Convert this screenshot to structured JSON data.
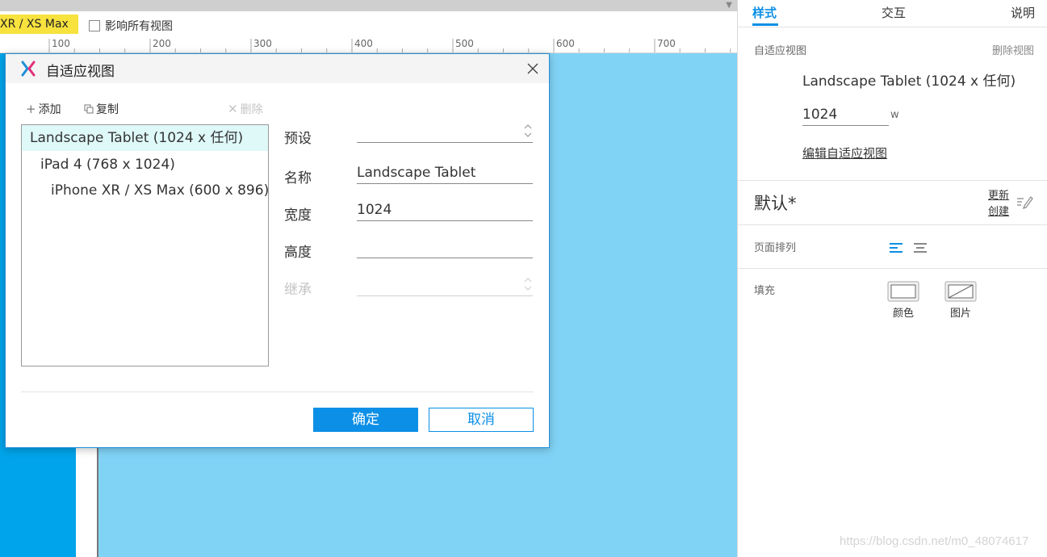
{
  "toolbar": {
    "current_view_chip": "XR / XS Max",
    "affect_all_views_label": "影响所有视图",
    "affect_all_views_checked": false
  },
  "ruler": {
    "ticks": [
      "100",
      "200",
      "300",
      "400",
      "500",
      "600",
      "700"
    ]
  },
  "dialog": {
    "title": "自适应视图",
    "toolbar": {
      "add_label": "添加",
      "copy_label": "复制",
      "delete_label": "删除"
    },
    "views": [
      {
        "label": "Landscape Tablet (1024 x 任何)",
        "selected": true
      },
      {
        "label": "iPad 4 (768 x 1024)",
        "selected": false
      },
      {
        "label": "iPhone XR / XS Max (600 x 896)",
        "selected": false
      }
    ],
    "form": {
      "preset_label": "预设",
      "preset_value": "",
      "name_label": "名称",
      "name_value": "Landscape Tablet",
      "width_label": "宽度",
      "width_value": "1024",
      "height_label": "高度",
      "height_value": "",
      "inherit_label": "继承",
      "inherit_value": ""
    },
    "ok_label": "确定",
    "cancel_label": "取消"
  },
  "panel": {
    "tabs": [
      {
        "label": "样式",
        "active": true
      },
      {
        "label": "交互",
        "active": false
      },
      {
        "label": "说明",
        "active": false
      }
    ],
    "adaptive_view_label": "自适应视图",
    "delete_view_label": "删除视图",
    "current_view_name": "Landscape Tablet (1024 x 任何)",
    "width_value": "1024",
    "width_unit": "w",
    "edit_views_link": "编辑自适应视图",
    "page_style_name": "默认*",
    "update_label": "更新",
    "create_label": "创建",
    "page_align_label": "页面排列",
    "fill_label": "填充",
    "fill_color_label": "颜色",
    "fill_image_label": "图片"
  },
  "watermark": "https://blog.csdn.net/m0_48074617",
  "colors": {
    "accent": "#0c8fe6",
    "canvas_light": "#81d3f6",
    "canvas_dark": "#00a4ea",
    "view_chip": "#f7e23e",
    "selected_row": "#dff8f8"
  }
}
